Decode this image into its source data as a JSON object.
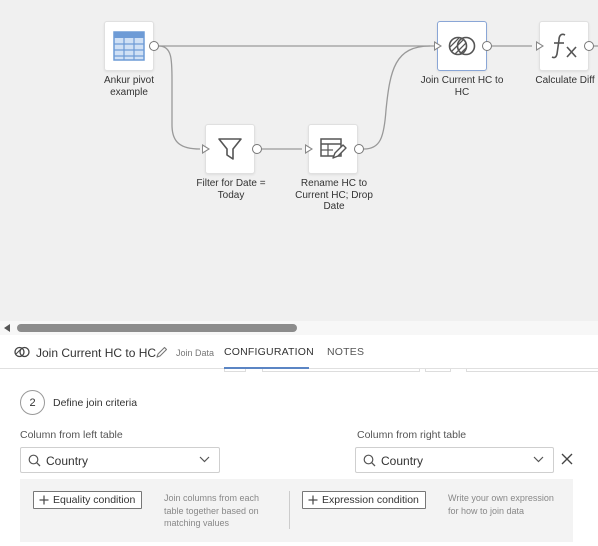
{
  "canvas": {
    "nodes": {
      "source": {
        "label": "Ankur pivot example",
        "icon": "table-icon"
      },
      "filter": {
        "label": "Filter for Date = Today",
        "icon": "filter-icon"
      },
      "rename": {
        "label": "Rename HC to Current HC; Drop Date",
        "icon": "edit-table-icon"
      },
      "join": {
        "label": "Join Current HC to HC",
        "icon": "join-icon"
      },
      "calc": {
        "label": "Calculate Diff",
        "icon": "function-icon"
      }
    },
    "selected_node": "join"
  },
  "panel": {
    "title": "Join Current HC to HC",
    "subtitle": "Join Data",
    "tabs": [
      {
        "label": "CONFIGURATION",
        "active": true
      },
      {
        "label": "NOTES",
        "active": false
      }
    ]
  },
  "step": {
    "number": "2",
    "label": "Define join criteria"
  },
  "left_column": {
    "label": "Column from left table",
    "value": "Country"
  },
  "right_column": {
    "label": "Column from right table",
    "value": "Country"
  },
  "conditions": {
    "equality": {
      "label": "Equality condition",
      "description": "Join columns from each table together based on matching values"
    },
    "expression": {
      "label": "Expression condition",
      "description": "Write your own expression for how to join data"
    }
  },
  "colors": {
    "accent": "#5b85c4",
    "canvas_bg": "#f0f0f0",
    "selected_border": "#8aa6d6"
  }
}
